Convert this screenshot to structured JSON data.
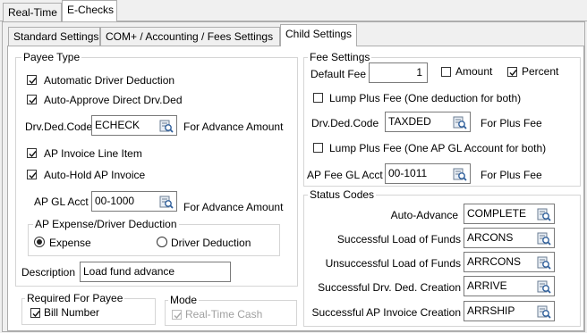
{
  "tabs_top": {
    "realtime": "Real-Time",
    "echecks": "E-Checks"
  },
  "tabs_sub": {
    "standard": "Standard Settings",
    "com": "COM+ / Accounting / Fees Settings",
    "child": "Child Settings"
  },
  "payee_type": {
    "title": "Payee Type",
    "auto_driver_deduction": "Automatic Driver Deduction",
    "auto_approve": "Auto-Approve Direct Drv.Ded",
    "drv_ded_code_label": "Drv.Ded.Code",
    "drv_ded_code_value": "ECHECK",
    "for_advance_1": "For Advance Amount",
    "ap_invoice_line": "AP Invoice Line Item",
    "auto_hold": "Auto-Hold AP Invoice",
    "ap_gl_label": "AP GL Acct",
    "ap_gl_value": "00-1000",
    "for_advance_2": "For Advance Amount",
    "expense_group_title": "AP Expense/Driver Deduction",
    "expense": "Expense",
    "driver_deduction": "Driver Deduction",
    "selected": "Expense",
    "description_label": "Description",
    "description_value": "Load fund advance"
  },
  "required": {
    "title": "Required For Payee",
    "bill_number": "Bill Number"
  },
  "mode": {
    "title": "Mode",
    "realtime_cash": "Real-Time Cash"
  },
  "fee_settings": {
    "title": "Fee Settings",
    "default_fee_label": "Default Fee",
    "default_fee_value": "1",
    "amount": "Amount",
    "percent": "Percent",
    "lump_plus_fee_1": "Lump Plus Fee (One deduction for both)",
    "drv_ded_code_label": "Drv.Ded.Code",
    "drv_ded_code_value": "TAXDED",
    "for_plus_fee_1": "For Plus Fee",
    "lump_plus_fee_2": "Lump Plus Fee (One AP GL Account for both)",
    "ap_fee_gl_label": "AP Fee GL Acct",
    "ap_fee_gl_value": "00-1011",
    "for_plus_fee_2": "For Plus Fee"
  },
  "status_codes": {
    "title": "Status Codes",
    "rows": [
      {
        "label": "Auto-Advance",
        "value": "COMPLETE"
      },
      {
        "label": "Successful Load of Funds",
        "value": "ARCONS"
      },
      {
        "label": "Unsuccessful Load of Funds",
        "value": "ARRCONS"
      },
      {
        "label": "Successful Drv. Ded. Creation",
        "value": "ARRIVE"
      },
      {
        "label": "Successful AP Invoice Creation",
        "value": "ARRSHIP"
      }
    ]
  }
}
